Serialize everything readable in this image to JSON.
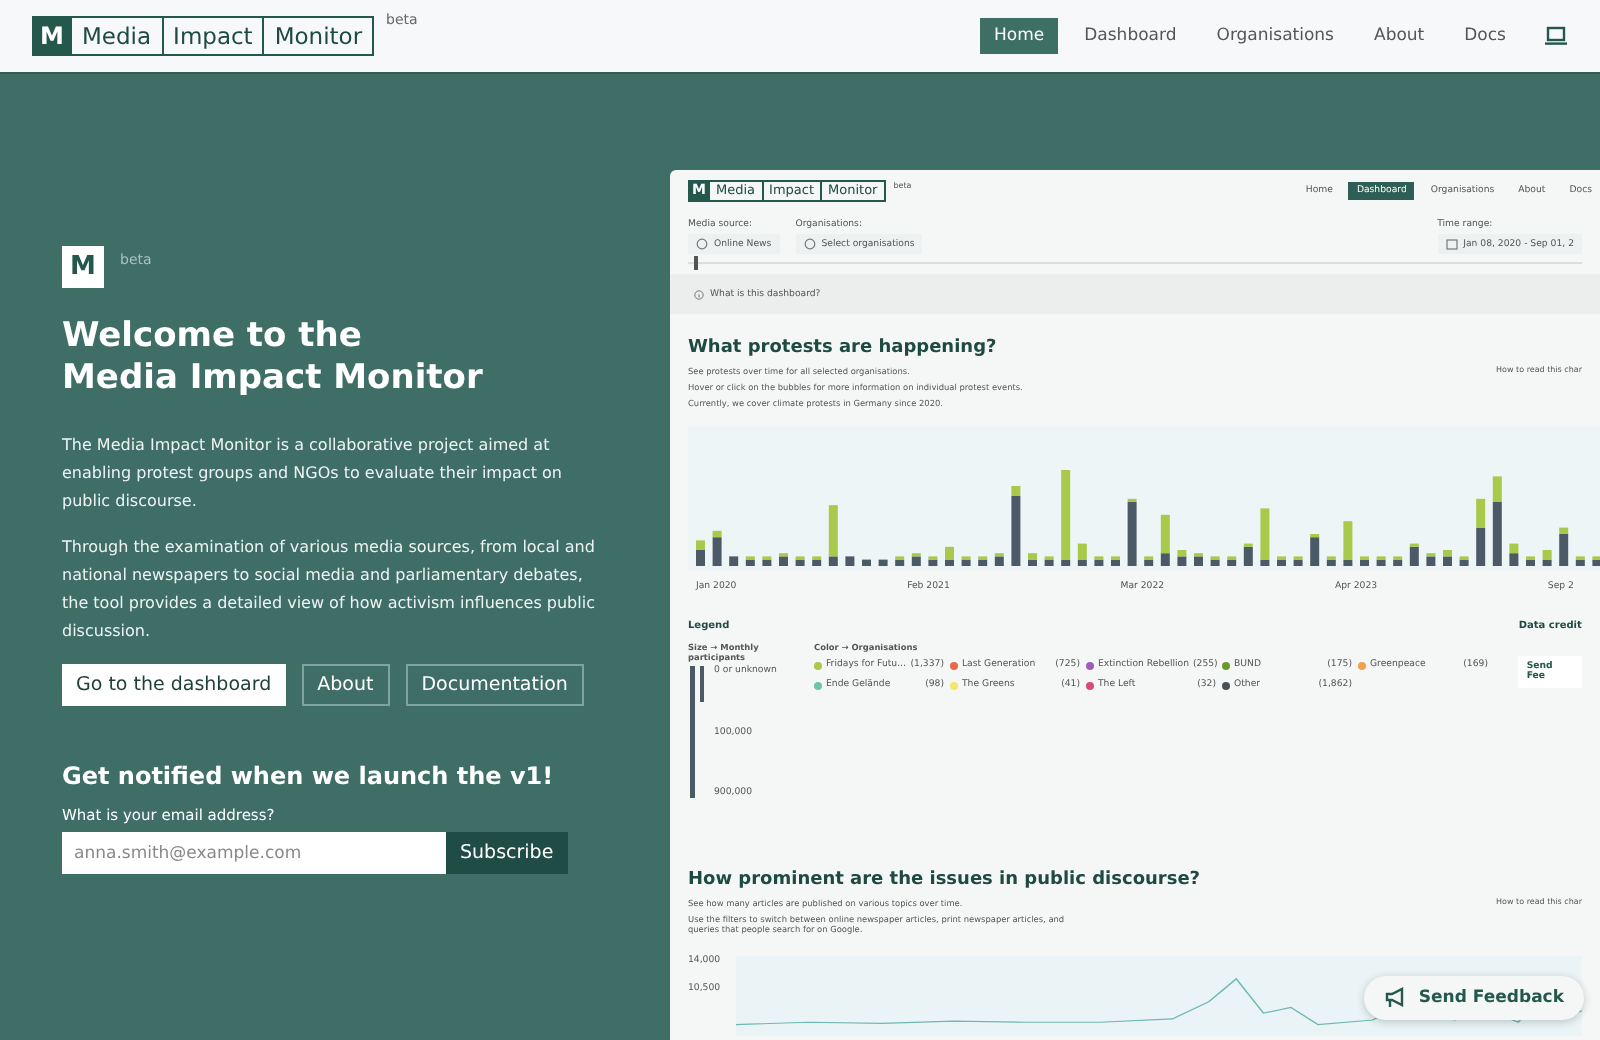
{
  "header": {
    "logo": {
      "mark": "M",
      "words": [
        "Media",
        "Impact",
        "Monitor"
      ],
      "badge": "beta"
    },
    "nav": [
      {
        "label": "Home",
        "selected": true
      },
      {
        "label": "Dashboard",
        "selected": false
      },
      {
        "label": "Organisations",
        "selected": false
      },
      {
        "label": "About",
        "selected": false
      },
      {
        "label": "Docs",
        "selected": false
      }
    ]
  },
  "hero": {
    "mark": "M",
    "badge": "beta",
    "title_lines": [
      "Welcome to the",
      "Media Impact Monitor"
    ],
    "paragraphs": [
      "The Media Impact Monitor is a collaborative project aimed at enabling protest groups and NGOs to evaluate their impact on public discourse.",
      "Through the examination of various media sources, from local and national newspapers to social media and parliamentary debates, the tool provides a detailed view of how activism influences public discussion."
    ],
    "buttons": [
      {
        "label": "Go to the dashboard",
        "kind": "primary"
      },
      {
        "label": "About",
        "kind": "outline"
      },
      {
        "label": "Documentation",
        "kind": "outline"
      }
    ],
    "signup": {
      "heading": "Get notified when we launch the v1!",
      "label": "What is your email address?",
      "placeholder": "anna.smith@example.com",
      "button": "Subscribe"
    }
  },
  "preview": {
    "logo": {
      "mark": "M",
      "words": [
        "Media",
        "Impact",
        "Monitor"
      ],
      "badge": "beta"
    },
    "nav": [
      {
        "label": "Home",
        "selected": false
      },
      {
        "label": "Dashboard",
        "selected": true
      },
      {
        "label": "Organisations",
        "selected": false
      },
      {
        "label": "About",
        "selected": false
      },
      {
        "label": "Docs",
        "selected": false
      }
    ],
    "filters": [
      {
        "label": "Media source:",
        "value": "Online News"
      },
      {
        "label": "Organisations:",
        "value": "Select organisations"
      }
    ],
    "time_range": {
      "label": "Time range:",
      "value": "Jan 08, 2020 - Sep 01, 2"
    },
    "timeline": {
      "level": 0
    },
    "help_link": "What is this dashboard?",
    "protests": {
      "title": "What protests are happening?",
      "lines": [
        "See protests over time for all selected organisations.",
        "Hover or click on the bubbles for more information on individual protest events.",
        "Currently, we cover climate protests in Germany since 2020."
      ],
      "how_to": "How to read this char",
      "x_labels": [
        "Jan 2020",
        "Feb 2021",
        "Mar 2022",
        "Apr 2023",
        "Sep 2"
      ]
    },
    "legend": {
      "title": "Legend",
      "size_heading": "Size → Monthly participants",
      "size_labels": [
        "0 or unknown",
        "100,000",
        "900,000"
      ],
      "color_heading": "Color → Organisations",
      "orgs": [
        {
          "name": "Fridays for Futu...",
          "count": "(1,337)",
          "color": "#a8c94a"
        },
        {
          "name": "Last Generation",
          "count": "(725)",
          "color": "#e8684a"
        },
        {
          "name": "Extinction Rebellion",
          "count": "(255)",
          "color": "#a05cb8"
        },
        {
          "name": "BUND",
          "count": "(175)",
          "color": "#6a9a2a"
        },
        {
          "name": "Greenpeace",
          "count": "(169)",
          "color": "#f2a24a"
        },
        {
          "name": "Ende Gelände",
          "count": "(98)",
          "color": "#6cc4a8"
        },
        {
          "name": "The Greens",
          "count": "(41)",
          "color": "#f4e66a"
        },
        {
          "name": "The Left",
          "count": "(32)",
          "color": "#d84a7a"
        },
        {
          "name": "Other",
          "count": "(1,862)",
          "color": "#4a4f58"
        }
      ]
    },
    "data_credit": "Data credit",
    "side_feedback": "Send Fee",
    "prominence": {
      "title": "How prominent are the issues in public discourse?",
      "lines": [
        "See how many articles are published on various topics over time.",
        "Use the filters to switch between online newspaper articles, print newspaper articles, and queries that people search for on Google."
      ],
      "how_to": "How to read this char",
      "y_labels": [
        "14,000",
        "10,500"
      ]
    }
  },
  "feedback_button": "Send Feedback"
}
